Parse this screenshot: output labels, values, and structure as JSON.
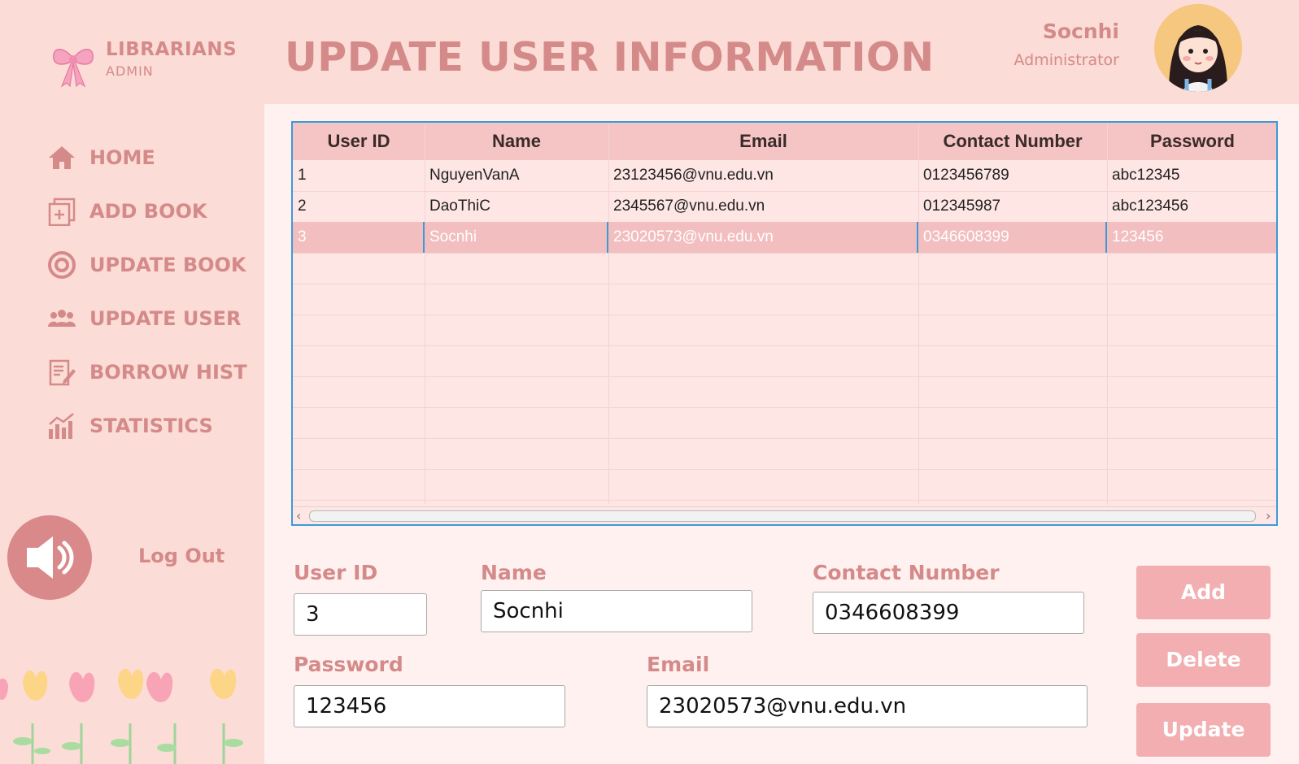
{
  "brand": {
    "title": "LIBRARIANS",
    "subtitle": "ADMIN"
  },
  "nav": [
    {
      "label": "HOME",
      "icon": "home-icon"
    },
    {
      "label": "ADD BOOK",
      "icon": "add-book-icon"
    },
    {
      "label": "UPDATE BOOK",
      "icon": "update-book-icon"
    },
    {
      "label": "UPDATE USER",
      "icon": "users-icon"
    },
    {
      "label": "BORROW HIST",
      "icon": "borrow-history-icon"
    },
    {
      "label": "STATISTICS",
      "icon": "statistics-icon"
    }
  ],
  "logout_label": "Log Out",
  "page_title": "UPDATE USER INFORMATION",
  "user": {
    "name": "Socnhi",
    "role": "Administrator"
  },
  "table": {
    "columns": [
      "User ID",
      "Name",
      "Email",
      "Contact Number",
      "Password"
    ],
    "rows": [
      [
        "1",
        "NguyenVanA",
        "23123456@vnu.edu.vn",
        "0123456789",
        "abc12345"
      ],
      [
        "2",
        "DaoThiC",
        "2345567@vnu.edu.vn",
        "012345987",
        "abc123456"
      ],
      [
        "3",
        "Socnhi",
        "23020573@vnu.edu.vn",
        "0346608399",
        "123456"
      ]
    ],
    "selected_row": 2
  },
  "form": {
    "user_id_label": "User ID",
    "user_id_value": "3",
    "name_label": "Name",
    "name_value": "Socnhi",
    "contact_label": "Contact Number",
    "contact_value": "0346608399",
    "password_label": "Password",
    "password_value": "123456",
    "email_label": "Email",
    "email_value": "23020573@vnu.edu.vn"
  },
  "buttons": {
    "add": "Add",
    "delete": "Delete",
    "update": "Update"
  },
  "colors": {
    "accent": "#d58a8a",
    "background": "#fbdcd6",
    "button": "#f2aeb0",
    "selection": "#f2bebf",
    "table_border": "#3d9ad8"
  }
}
